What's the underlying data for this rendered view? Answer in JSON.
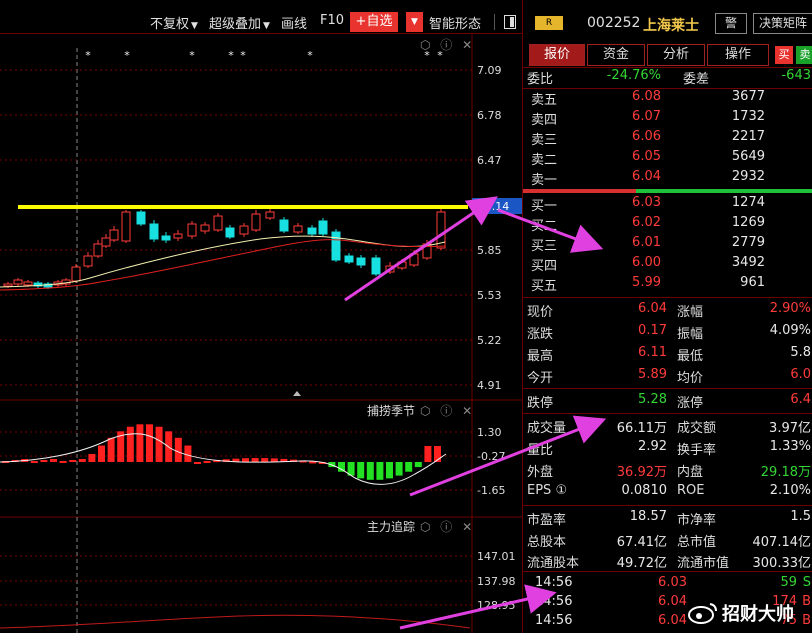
{
  "toolbar": {
    "adjust_label": "不复权",
    "overlay_label": "超级叠加",
    "draw_label": "画线",
    "f10_label": "F10",
    "add_watchlist_label": "+自选",
    "pattern_label": "智能形态"
  },
  "price_axis": [
    "7.09",
    "6.78",
    "6.47",
    "6.14",
    "5.85",
    "5.53",
    "5.22",
    "4.91"
  ],
  "current_price_tag": "6.14",
  "panes": {
    "indicator1": {
      "title": "捕捞季节",
      "ticks": [
        "1.30",
        "-0.27",
        "-1.65"
      ]
    },
    "indicator2": {
      "title": "主力追踪",
      "ticks": [
        "147.01",
        "137.98",
        "128.95"
      ]
    }
  },
  "quote": {
    "badge": "R",
    "code": "002252",
    "name": "上海莱士",
    "alert_label": "警",
    "decision_label": "决策矩阵"
  },
  "tabs": [
    "报价",
    "资金",
    "分析",
    "操作"
  ],
  "buy_mini": "买",
  "sell_mini": "卖",
  "committee": {
    "ratio_label": "委比",
    "ratio_value": "-24.76%",
    "diff_label": "委差",
    "diff_value": "-643"
  },
  "asks": [
    {
      "label": "卖五",
      "price": "6.08",
      "vol": "3677"
    },
    {
      "label": "卖四",
      "price": "6.07",
      "vol": "1732"
    },
    {
      "label": "卖三",
      "price": "6.06",
      "vol": "2217"
    },
    {
      "label": "卖二",
      "price": "6.05",
      "vol": "5649"
    },
    {
      "label": "卖一",
      "price": "6.04",
      "vol": "2932"
    }
  ],
  "bids": [
    {
      "label": "买一",
      "price": "6.03",
      "vol": "1274"
    },
    {
      "label": "买二",
      "price": "6.02",
      "vol": "1269"
    },
    {
      "label": "买三",
      "price": "6.01",
      "vol": "2779"
    },
    {
      "label": "买四",
      "price": "6.00",
      "vol": "3492"
    },
    {
      "label": "买五",
      "price": "5.99",
      "vol": "961"
    }
  ],
  "stats": [
    {
      "l1": "现价",
      "v1": "6.04",
      "c1": "red",
      "l2": "涨幅",
      "v2": "2.90%",
      "c2": "red"
    },
    {
      "l1": "涨跌",
      "v1": "0.17",
      "c1": "red",
      "l2": "振幅",
      "v2": "4.09%",
      "c2": "white"
    },
    {
      "l1": "最高",
      "v1": "6.11",
      "c1": "red",
      "l2": "最低",
      "v2": "5.8",
      "c2": "white"
    },
    {
      "l1": "今开",
      "v1": "5.89",
      "c1": "red",
      "l2": "均价",
      "v2": "6.0",
      "c2": "red"
    },
    {
      "l1": "跌停",
      "v1": "5.28",
      "c1": "green",
      "l2": "涨停",
      "v2": "6.4",
      "c2": "red"
    },
    {
      "l1": "成交量",
      "v1": "66.11万",
      "c1": "white",
      "l2": "成交额",
      "v2": "3.97亿",
      "c2": "white"
    },
    {
      "l1": "量比",
      "v1": "2.92",
      "c1": "white",
      "l2": "换手率",
      "v2": "1.33%",
      "c2": "white"
    },
    {
      "l1": "外盘",
      "v1": "36.92万",
      "c1": "red",
      "l2": "内盘",
      "v2": "29.18万",
      "c2": "green"
    },
    {
      "l1": "EPS ①",
      "v1": "0.0810",
      "c1": "white",
      "l2": "ROE",
      "v2": "2.10%",
      "c2": "white"
    },
    {
      "l1": "市盈率",
      "v1": "18.57",
      "c1": "white",
      "l2": "市净率",
      "v2": "1.5",
      "c2": "white"
    },
    {
      "l1": "总股本",
      "v1": "67.41亿",
      "c1": "white",
      "l2": "总市值",
      "v2": "407.14亿",
      "c2": "white"
    },
    {
      "l1": "流通股本",
      "v1": "49.72亿",
      "c1": "white",
      "l2": "流通市值",
      "v2": "300.33亿",
      "c2": "white"
    }
  ],
  "ticks": [
    {
      "time": "14:56",
      "price": "6.03",
      "vol": "59",
      "dir": "S"
    },
    {
      "time": "14:56",
      "price": "6.04",
      "vol": "174",
      "dir": "B"
    },
    {
      "time": "14:56",
      "price": "6.04",
      "vol": "75",
      "dir": "B"
    }
  ],
  "watermark": "招财大帅",
  "colors": {
    "up": "#ff3b3b",
    "down": "#19e0e0",
    "accent": "#e8332e",
    "highlight_line": "#ffff00",
    "arrow": "#e040e0"
  }
}
